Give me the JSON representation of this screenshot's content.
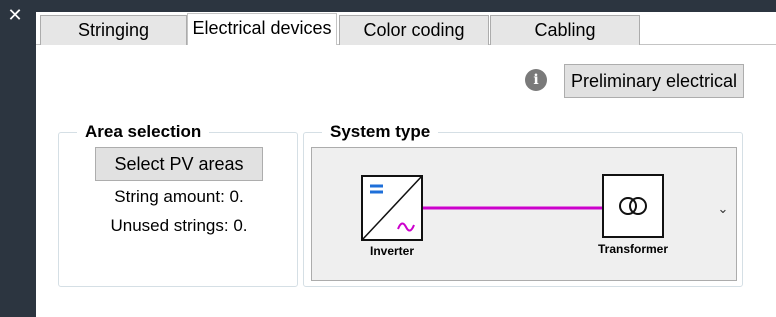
{
  "window": {
    "close_icon": "close-icon",
    "close_glyph": "✕"
  },
  "tabs": [
    {
      "label": "Stringing",
      "active": false
    },
    {
      "label": "Electrical devices",
      "active": true
    },
    {
      "label": "Color coding",
      "active": false
    },
    {
      "label": "Cabling",
      "active": false
    }
  ],
  "toolbar": {
    "info_icon": "info-icon",
    "info_glyph": "i",
    "preliminary_label": "Preliminary electrical"
  },
  "area_selection": {
    "title": "Area selection",
    "select_button": "Select PV areas",
    "string_amount": "String amount: 0.",
    "unused_strings": "Unused strings: 0."
  },
  "system_type": {
    "title": "System type",
    "inverter_label": "Inverter",
    "transformer_label": "Transformer",
    "chevron_icon": "chevron-down-icon",
    "chevron_glyph": "⌄"
  },
  "colors": {
    "connection_line": "#cc00cc",
    "dc_symbol": "#1e6fd9",
    "ac_symbol": "#cc00cc",
    "rail": "#2c3540"
  }
}
